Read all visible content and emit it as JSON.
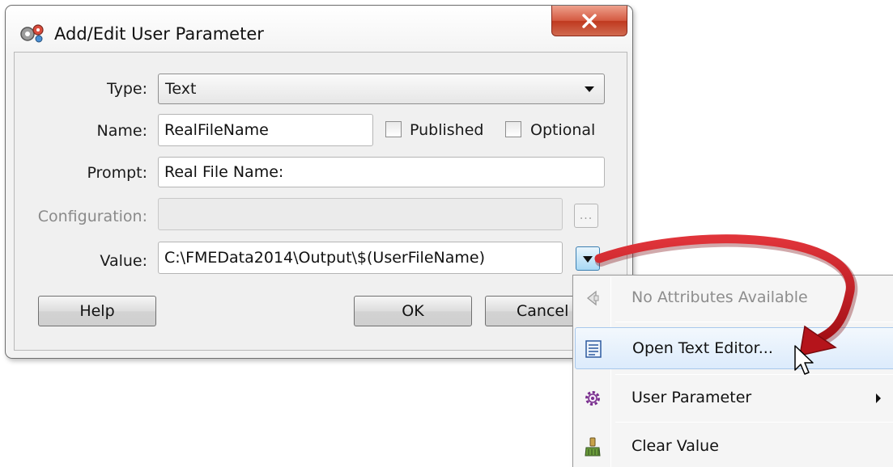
{
  "window": {
    "title": "Add/Edit User Parameter",
    "close_glyph": "✕"
  },
  "form": {
    "type_label": "Type:",
    "type_value": "Text",
    "name_label": "Name:",
    "name_value": "RealFileName",
    "published_label": "Published",
    "optional_label": "Optional",
    "prompt_label": "Prompt:",
    "prompt_value": "Real File Name:",
    "configuration_label": "Configuration:",
    "configuration_value": "",
    "configuration_button": "...",
    "value_label": "Value:",
    "value_value": "C:\\FMEData2014\\Output\\$(UserFileName)"
  },
  "buttons": {
    "help": "Help",
    "ok": "OK",
    "cancel": "Cancel"
  },
  "context_menu": {
    "items": [
      {
        "label": "No Attributes Available",
        "icon": "attribute-arrow-icon",
        "enabled": false
      },
      {
        "label": "Open Text Editor...",
        "icon": "text-editor-icon",
        "enabled": true,
        "hovered": true
      },
      {
        "label": "User Parameter",
        "icon": "gear-icon",
        "enabled": true,
        "submenu": true
      },
      {
        "label": "Clear Value",
        "icon": "broom-icon",
        "enabled": true
      }
    ]
  },
  "colors": {
    "arrow_annotation": "#c0141a",
    "close_button": "#c7462c",
    "menu_hover": "#dcebfc"
  }
}
